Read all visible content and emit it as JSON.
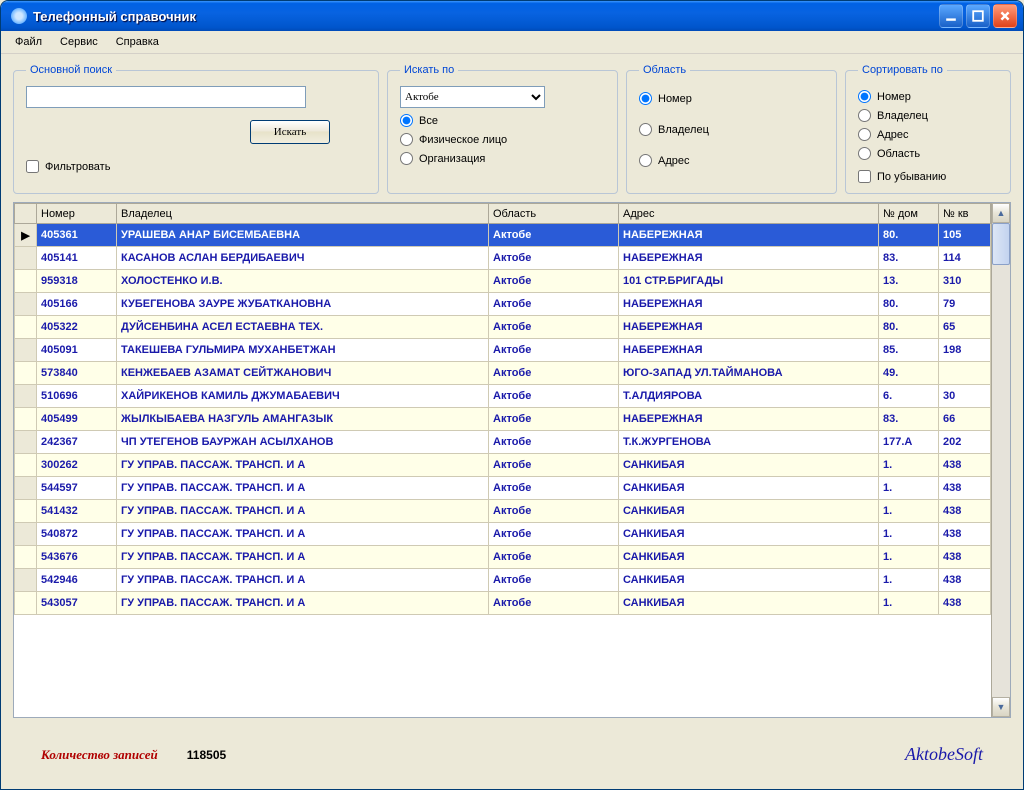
{
  "window": {
    "title": "Телефонный справочник"
  },
  "menu": {
    "file": "Файл",
    "service": "Сервис",
    "help": "Справка"
  },
  "search": {
    "legend": "Основной поиск",
    "value": "",
    "button": "Искать",
    "filter": "Фильтровать"
  },
  "searchBy": {
    "legend": "Искать по",
    "regionSelected": "Актобе",
    "all": "Все",
    "person": "Физическое лицо",
    "org": "Организация"
  },
  "region": {
    "legend": "Область",
    "number": "Номер",
    "owner": "Владелец",
    "address": "Адрес"
  },
  "sort": {
    "legend": "Сортировать по",
    "number": "Номер",
    "owner": "Владелец",
    "address": "Адрес",
    "region": "Область",
    "desc": "По убыванию"
  },
  "grid": {
    "cols": {
      "number": "Номер",
      "owner": "Владелец",
      "region": "Область",
      "address": "Адрес",
      "house": "№ дом",
      "flat": "№ кв"
    },
    "rows": [
      {
        "n": "405361",
        "owner": "УРАШЕВА АНАР БИСЕМБАЕВНА",
        "reg": "Актобе",
        "addr": "НАБЕРЕЖНАЯ",
        "h": "80.",
        "f": "105"
      },
      {
        "n": "405141",
        "owner": "КАСАНОВ АСЛАН БЕРДИБАЕВИЧ",
        "reg": "Актобе",
        "addr": "НАБЕРЕЖНАЯ",
        "h": "83.",
        "f": "114"
      },
      {
        "n": "959318",
        "owner": "ХОЛОСТЕНКО И.В.",
        "reg": "Актобе",
        "addr": "101 СТР.БРИГАДЫ",
        "h": "13.",
        "f": "310"
      },
      {
        "n": "405166",
        "owner": "КУБЕГЕНОВА ЗАУРЕ ЖУБАТКАНОВНА",
        "reg": "Актобе",
        "addr": "НАБЕРЕЖНАЯ",
        "h": "80.",
        "f": "79"
      },
      {
        "n": "405322",
        "owner": "ДУЙСЕНБИНА АСЕЛ ЕСТАЕВНА ТЕХ.",
        "reg": "Актобе",
        "addr": "НАБЕРЕЖНАЯ",
        "h": "80.",
        "f": "65"
      },
      {
        "n": "405091",
        "owner": "ТАКЕШЕВА ГУЛЬМИРА МУХАНБЕТЖАН",
        "reg": "Актобе",
        "addr": "НАБЕРЕЖНАЯ",
        "h": "85.",
        "f": "198"
      },
      {
        "n": "573840",
        "owner": "КЕНЖЕБАЕВ АЗАМАТ СЕЙТЖАНОВИЧ",
        "reg": "Актобе",
        "addr": "ЮГО-ЗАПАД УЛ.ТАЙМАНОВА",
        "h": "49.",
        "f": ""
      },
      {
        "n": "510696",
        "owner": "ХАЙРИКЕНОВ КАМИЛЬ ДЖУМАБАЕВИЧ",
        "reg": "Актобе",
        "addr": "Т.АЛДИЯРОВА",
        "h": "6.",
        "f": "30"
      },
      {
        "n": "405499",
        "owner": "ЖЫЛКЫБАЕВА НАЗГУЛЬ АМАНГАЗЫК",
        "reg": "Актобе",
        "addr": "НАБЕРЕЖНАЯ",
        "h": "83.",
        "f": "66"
      },
      {
        "n": "242367",
        "owner": "ЧП УТЕГЕНОВ БАУРЖАН АСЫЛХАНОВ",
        "reg": "Актобе",
        "addr": "Т.К.ЖУРГЕНОВА",
        "h": "177.А",
        "f": "202"
      },
      {
        "n": "300262",
        "owner": "ГУ  УПРАВ. ПАССАЖ. ТРАНСП. И А",
        "reg": "Актобе",
        "addr": "САНКИБАЯ",
        "h": "1.",
        "f": "438"
      },
      {
        "n": "544597",
        "owner": "ГУ  УПРАВ. ПАССАЖ. ТРАНСП. И А",
        "reg": "Актобе",
        "addr": "САНКИБАЯ",
        "h": "1.",
        "f": "438"
      },
      {
        "n": "541432",
        "owner": "ГУ  УПРАВ. ПАССАЖ. ТРАНСП. И А",
        "reg": "Актобе",
        "addr": "САНКИБАЯ",
        "h": "1.",
        "f": "438"
      },
      {
        "n": "540872",
        "owner": "ГУ  УПРАВ. ПАССАЖ. ТРАНСП. И А",
        "reg": "Актобе",
        "addr": "САНКИБАЯ",
        "h": "1.",
        "f": "438"
      },
      {
        "n": "543676",
        "owner": "ГУ  УПРАВ. ПАССАЖ. ТРАНСП. И А",
        "reg": "Актобе",
        "addr": "САНКИБАЯ",
        "h": "1.",
        "f": "438"
      },
      {
        "n": "542946",
        "owner": "ГУ  УПРАВ. ПАССАЖ. ТРАНСП. И А",
        "reg": "Актобе",
        "addr": "САНКИБАЯ",
        "h": "1.",
        "f": "438"
      },
      {
        "n": "543057",
        "owner": "ГУ  УПРАВ. ПАССАЖ. ТРАНСП. И А",
        "reg": "Актобе",
        "addr": "САНКИБАЯ",
        "h": "1.",
        "f": "438"
      }
    ]
  },
  "footer": {
    "countLabel": "Количество записей",
    "countValue": "118505",
    "brand": "AktobeSoft"
  }
}
